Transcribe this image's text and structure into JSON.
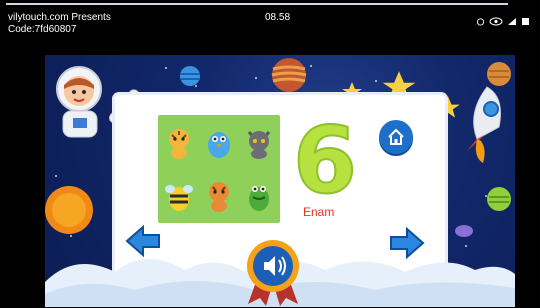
{
  "status_bar": {
    "brand": "vilytouch.com Presents",
    "code": "Code:7fd60807",
    "time": "08.58"
  },
  "screen": {
    "number_shown": "6",
    "number_word": "Enam",
    "animals": [
      "tiger",
      "bird",
      "cat",
      "bee",
      "tiger",
      "crocodile"
    ]
  },
  "buttons": {
    "home": "home-icon",
    "back": "arrow-left-icon",
    "next": "arrow-right-icon",
    "sound": "speaker-icon"
  },
  "colors": {
    "space": "#12286b",
    "number": "#b7e13e",
    "word": "#e53320",
    "button_blue": "#1e6fc9"
  }
}
